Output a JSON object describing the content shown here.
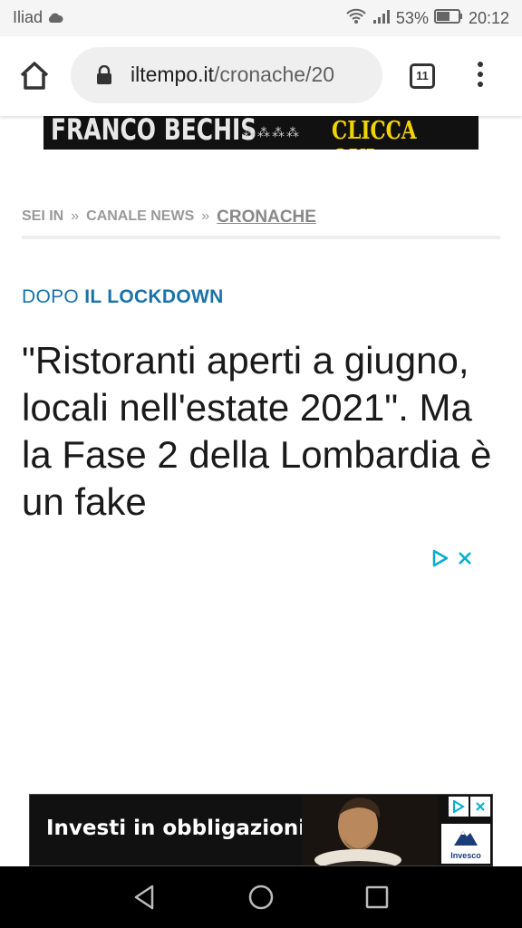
{
  "status_bar": {
    "carrier": "Iliad",
    "battery_percent": "53%",
    "time": "20:12"
  },
  "browser": {
    "url_domain": "iltempo.it",
    "url_path": "/cronache/20",
    "tab_count": "11"
  },
  "top_banner": {
    "name_text": "FRANCO BECHIS",
    "cta_text": "CLICCA QUI"
  },
  "breadcrumb": {
    "items": [
      "SEI IN",
      "CANALE NEWS",
      "CRONACHE"
    ],
    "separator": "»"
  },
  "article": {
    "kicker_part1": "DOPO",
    "kicker_part2": "IL LOCKDOWN",
    "headline": "\"Ristoranti aperti a giugno, locali nell'estate 2021\". Ma la Fase 2 della Lombardia è un fake"
  },
  "bottom_ad": {
    "text": "Investi in obbligazioni.",
    "brand": "Invesco"
  },
  "colors": {
    "kicker": "#1a73a8",
    "adchoices": "#00aecd",
    "banner_cta": "#f2d400"
  },
  "icons": [
    "cloud-icon",
    "wifi-icon",
    "signal-icon",
    "battery-icon",
    "home-icon",
    "lock-icon",
    "tabs-icon",
    "more-vert-icon",
    "adchoices-icon",
    "close-icon",
    "back-icon",
    "home-nav-icon",
    "recents-icon"
  ]
}
